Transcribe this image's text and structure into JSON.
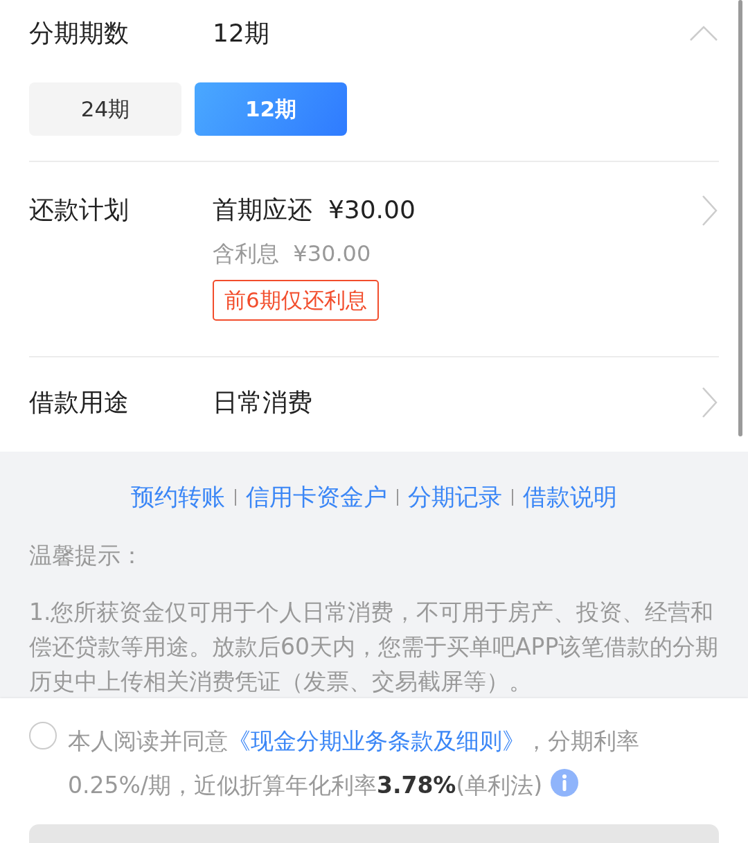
{
  "installment": {
    "label": "分期期数",
    "value": "12期",
    "expanded": true,
    "options": [
      {
        "label": "24期",
        "selected": false
      },
      {
        "label": "12期",
        "selected": true
      }
    ]
  },
  "plan": {
    "label": "还款计划",
    "first_payment": "首期应还  ¥30.00",
    "interest": "含利息  ¥30.00",
    "tag": "前6期仅还利息"
  },
  "purpose": {
    "label": "借款用途",
    "value": "日常消费"
  },
  "links": [
    "预约转账",
    "信用卡资金户",
    "分期记录",
    "借款说明"
  ],
  "tips": {
    "title": "温馨提示：",
    "text": "1.您所获资金仅可用于个人日常消费，不可用于房产、投资、经营和偿还贷款等用途。放款后60天内，您需于买单吧APP该笔借款的分期历史中上传相关消费凭证（发票、交易截屏等）。"
  },
  "agreement": {
    "checked": false,
    "prefix": "本人阅读并同意",
    "link": "《现金分期业务条款及细则》",
    "suffix": "，分期利率0.25%/期，近似折算年化利率**3.78%**(单利法)"
  }
}
